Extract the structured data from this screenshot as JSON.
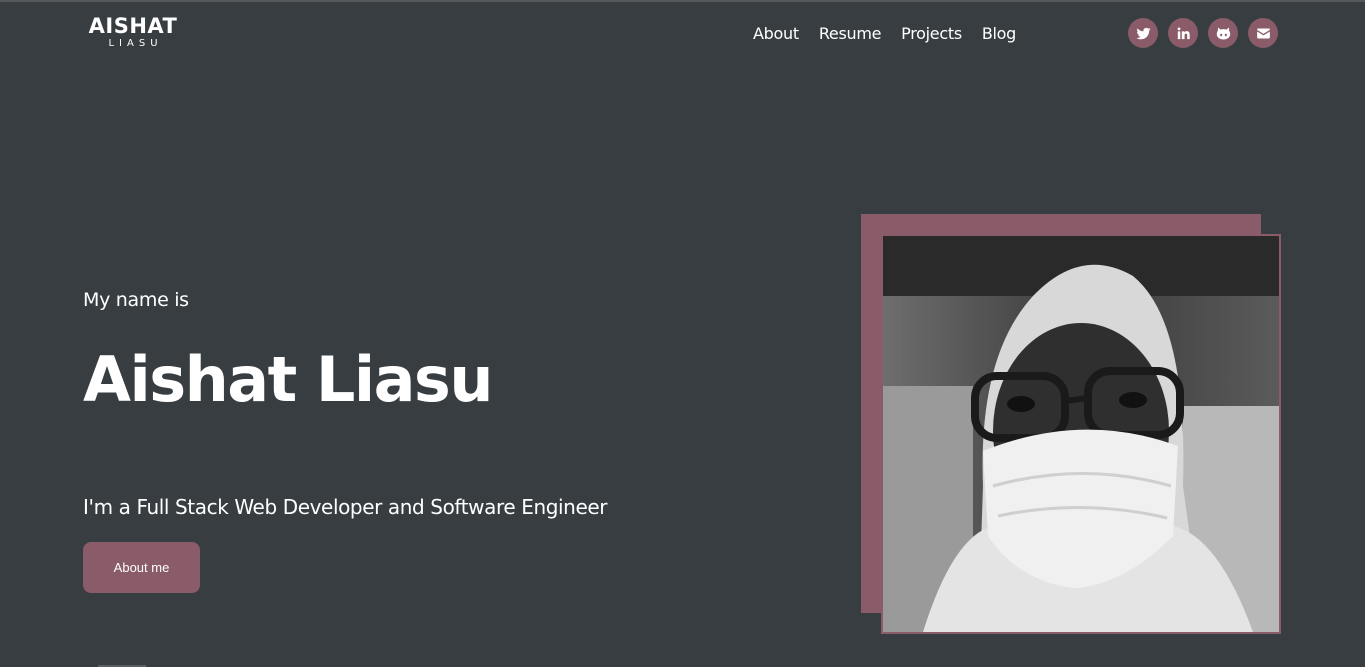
{
  "header": {
    "logo_main": "AISHAT",
    "logo_sub": "LIASU",
    "nav": [
      "About",
      "Resume",
      "Projects",
      "Blog"
    ],
    "social": [
      "twitter-icon",
      "linkedin-icon",
      "github-icon",
      "email-icon"
    ]
  },
  "hero": {
    "intro": "My name is",
    "name": "Aishat Liasu",
    "tagline": "I'm a Full Stack Web Developer and Software Engineer",
    "button_label": "About me"
  },
  "colors": {
    "background": "#373d41",
    "accent": "#8a5b68",
    "text": "#ffffff"
  }
}
